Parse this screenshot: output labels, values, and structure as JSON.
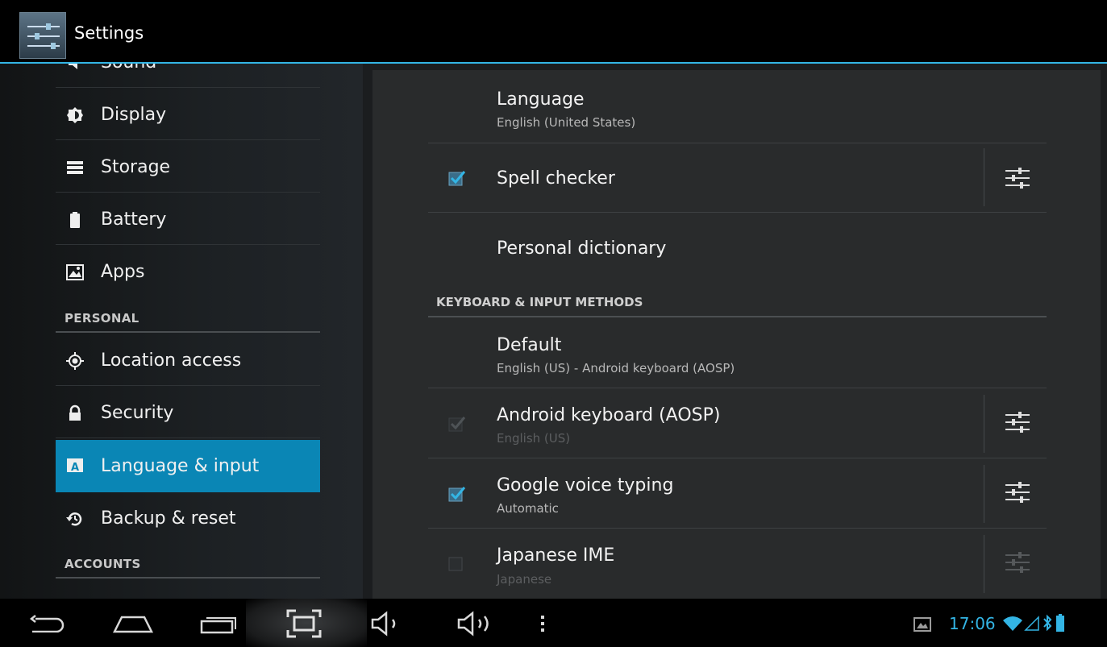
{
  "app": {
    "title": "Settings",
    "icon": "settings-sliders-icon"
  },
  "sidebar": {
    "partial_item": {
      "label": "Sound",
      "icon": "sound-icon"
    },
    "items": [
      {
        "label": "Display",
        "icon": "display-icon"
      },
      {
        "label": "Storage",
        "icon": "storage-icon"
      },
      {
        "label": "Battery",
        "icon": "battery-icon"
      },
      {
        "label": "Apps",
        "icon": "apps-icon"
      },
      {
        "label": "Location access",
        "icon": "location-icon"
      },
      {
        "label": "Security",
        "icon": "lock-icon"
      },
      {
        "label": "Language & input",
        "icon": "language-icon",
        "selected": true
      },
      {
        "label": "Backup & reset",
        "icon": "backup-icon"
      }
    ],
    "headers": {
      "personal": "PERSONAL",
      "accounts": "ACCOUNTS"
    }
  },
  "detail": {
    "language": {
      "title": "Language",
      "summary": "English (United States)"
    },
    "spell_checker": {
      "title": "Spell checker",
      "checked": true
    },
    "personal_dictionary": {
      "title": "Personal dictionary"
    },
    "keyboard_section": "KEYBOARD & INPUT METHODS",
    "default": {
      "title": "Default",
      "summary": "English (US) - Android keyboard (AOSP)"
    },
    "methods": [
      {
        "title": "Android keyboard (AOSP)",
        "summary": "English (US)",
        "checked": true,
        "enabled": false
      },
      {
        "title": "Google voice typing",
        "summary": "Automatic",
        "checked": true,
        "enabled": true
      },
      {
        "title": "Japanese IME",
        "summary": "Japanese",
        "checked": false,
        "enabled": false
      }
    ]
  },
  "navbar": {
    "buttons": [
      "back-icon",
      "home-icon",
      "recent-apps-icon",
      "screenshot-icon",
      "volume-down-icon",
      "volume-up-icon",
      "menu-icon"
    ]
  },
  "status": {
    "time": "17:06",
    "icons": [
      "gallery-icon",
      "wifi-icon",
      "signal-icon",
      "bluetooth-icon",
      "battery-icon"
    ]
  },
  "colors": {
    "accent": "#33b5e5",
    "selected": "#0a86b5",
    "background": "#000000"
  }
}
